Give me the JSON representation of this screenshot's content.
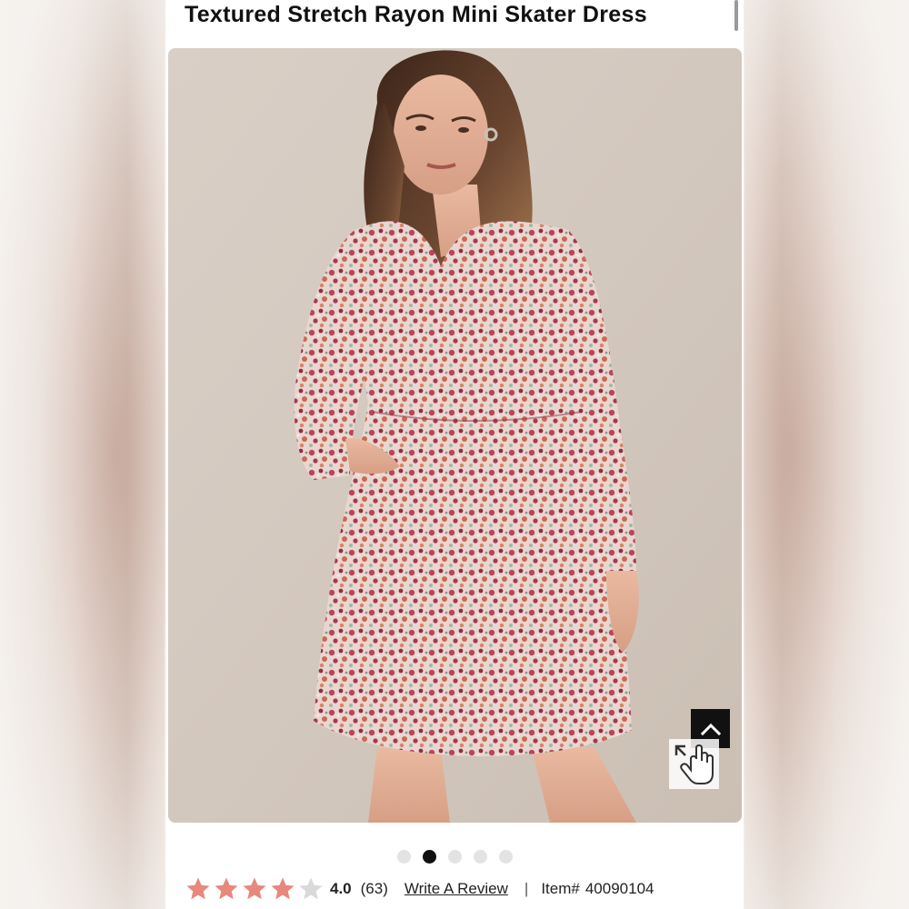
{
  "product": {
    "title": "Textured Stretch Rayon Mini Skater Dress",
    "image_alt": "Model wearing floral long-sleeve mini skater dress"
  },
  "gallery": {
    "total_images": 5,
    "active_index": 1
  },
  "controls": {
    "back_to_top_icon": "chevron-up-icon",
    "zoom_icon": "expand-hand-cursor-icon"
  },
  "rating": {
    "value": "4.0",
    "count": "(63)",
    "stars_filled": 4,
    "stars_total": 5,
    "star_color": "#e8877c",
    "star_empty_color": "#d9d9d9"
  },
  "review_link": "Write A Review",
  "separator": "|",
  "item": {
    "label": "Item#",
    "number": "40090104"
  },
  "colors": {
    "photo_background": "#d8cfc6",
    "dress_primary": "#b8455a",
    "active_dot": "#111111",
    "inactive_dot": "#e3e3e3"
  }
}
